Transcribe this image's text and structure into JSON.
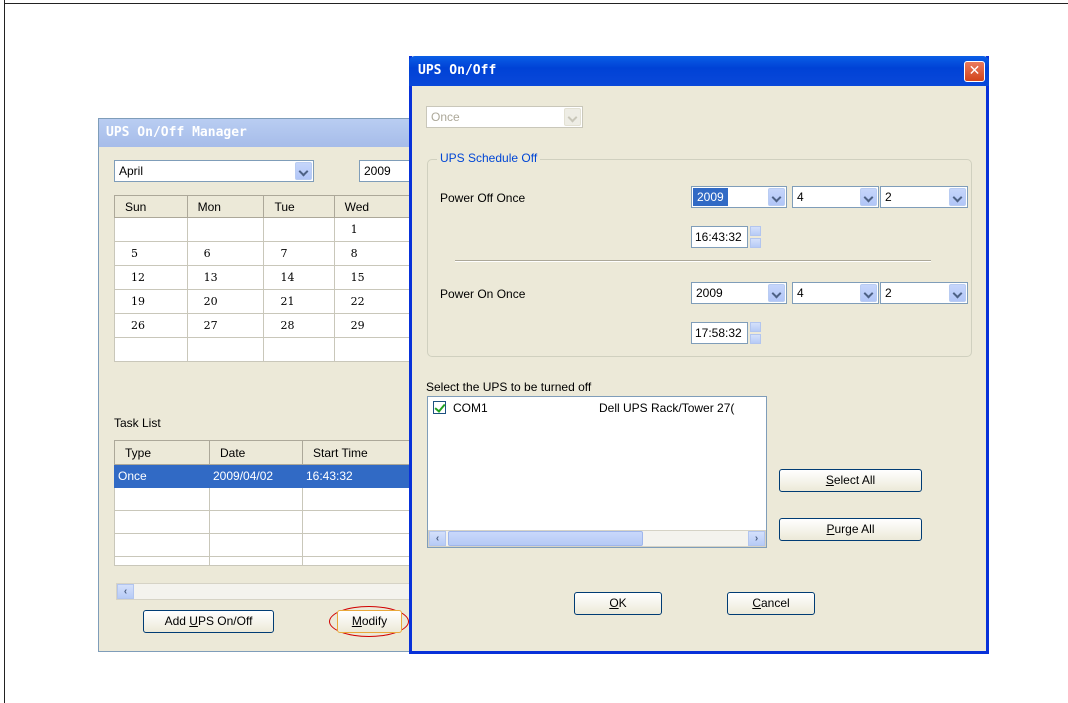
{
  "manager": {
    "title": "UPS On/Off Manager",
    "month": "April",
    "year": "2009",
    "calendar_headers": [
      "Sun",
      "Mon",
      "Tue",
      "Wed"
    ],
    "calendar_rows": [
      [
        "",
        "",
        "",
        "1"
      ],
      [
        "5",
        "6",
        "7",
        "8"
      ],
      [
        "12",
        "13",
        "14",
        "15"
      ],
      [
        "19",
        "20",
        "21",
        "22"
      ],
      [
        "26",
        "27",
        "28",
        "29"
      ],
      [
        "",
        "",
        "",
        ""
      ]
    ],
    "task_list_label": "Task List",
    "task_headers": [
      "Type",
      "Date",
      "Start Time"
    ],
    "task_rows": [
      [
        "Once",
        "2009/04/02",
        "16:43:32"
      ],
      [
        "",
        "",
        ""
      ],
      [
        "",
        "",
        ""
      ],
      [
        "",
        "",
        ""
      ],
      [
        "",
        "",
        ""
      ]
    ],
    "add_button": {
      "before": "Add ",
      "mnemonic": "U",
      "after": "PS On/Off"
    },
    "modify_button": {
      "mnemonic": "M",
      "after": "odify"
    }
  },
  "dialog": {
    "title": "UPS On/Off",
    "frequency": "Once",
    "group_label": "UPS Schedule Off",
    "power_off_label": "Power Off Once",
    "power_off": {
      "year": "2009",
      "month": "4",
      "day": "2",
      "time": "16:43:32"
    },
    "power_on_label": "Power On Once",
    "power_on": {
      "year": "2009",
      "month": "4",
      "day": "2",
      "time": "17:58:32"
    },
    "select_label": "Select the UPS to be turned off",
    "ups_list": [
      {
        "port": "COM1",
        "model": "Dell UPS Rack/Tower 27(",
        "checked": true
      }
    ],
    "select_all_button": {
      "mnemonic": "S",
      "after": "elect All"
    },
    "purge_all_button": {
      "mnemonic": "P",
      "after": "urge All"
    },
    "ok_button": {
      "mnemonic": "O",
      "after": "K"
    },
    "cancel_button": {
      "mnemonic": "C",
      "after": "ancel"
    },
    "close_symbol": "✕"
  },
  "colors": {
    "selection": "#316ac5",
    "titlebar_active": "#0a5ee6",
    "titlebar_inactive": "#a6bce9",
    "group_label": "#0046d5",
    "highlight_oval": "#d10000"
  }
}
